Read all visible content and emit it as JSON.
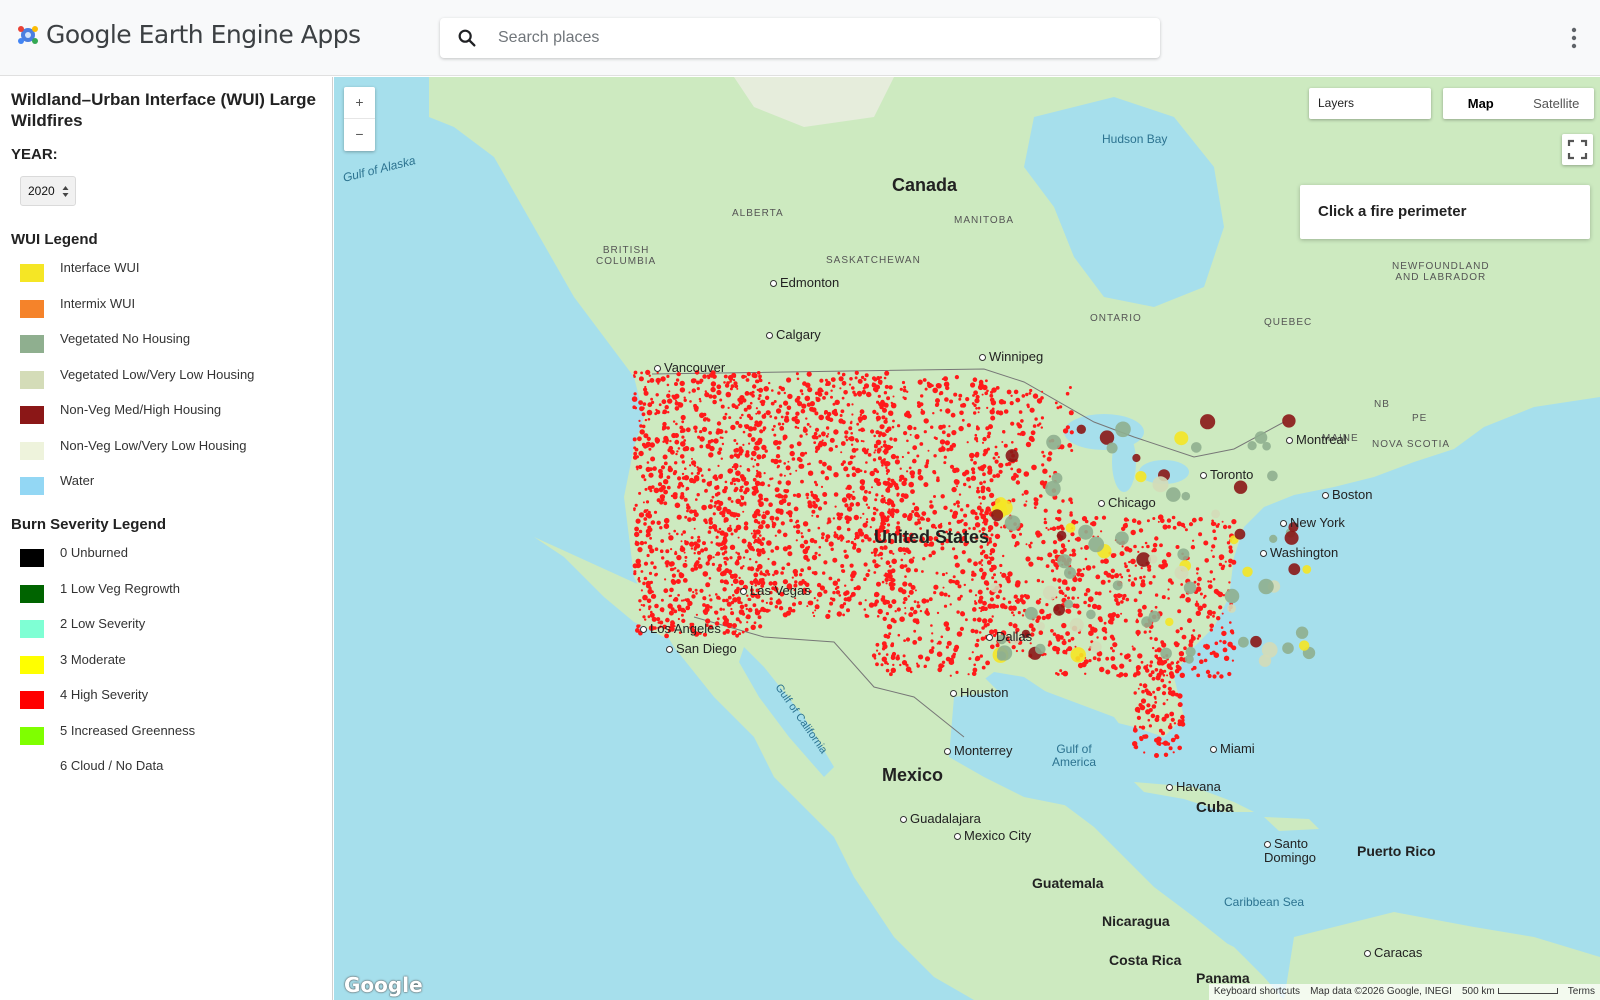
{
  "header": {
    "app_title": "Google Earth Engine Apps",
    "search_placeholder": "Search places"
  },
  "panel": {
    "title": "Wildland–Urban Interface (WUI) Large Wildfires",
    "year_label": "YEAR:",
    "year_value": "2020",
    "wui_legend": {
      "title": "WUI Legend",
      "items": [
        {
          "label": "Interface WUI",
          "color": "#f5e625"
        },
        {
          "label": "Intermix WUI",
          "color": "#f5832a"
        },
        {
          "label": "Vegetated No Housing",
          "color": "#8faf8f"
        },
        {
          "label": "Vegetated Low/Very Low Housing",
          "color": "#d4dcb8"
        },
        {
          "label": "Non-Veg Med/High Housing",
          "color": "#8b1717"
        },
        {
          "label": "Non-Veg Low/Very Low Housing",
          "color": "#eef3dc"
        },
        {
          "label": "Water",
          "color": "#93d7f4"
        }
      ]
    },
    "burn_legend": {
      "title": "Burn Severity Legend",
      "items": [
        {
          "label": "0 Unburned",
          "color": "#000000"
        },
        {
          "label": "1 Low Veg Regrowth",
          "color": "#006400"
        },
        {
          "label": "2 Low Severity",
          "color": "#7fffd4"
        },
        {
          "label": "3 Moderate",
          "color": "#ffff00"
        },
        {
          "label": "4 High Severity",
          "color": "#ff0000"
        },
        {
          "label": "5 Increased Greenness",
          "color": "#7fff00"
        },
        {
          "label": "6 Cloud / No Data",
          "color": "#ffffff"
        }
      ]
    }
  },
  "map": {
    "zoom_in": "+",
    "zoom_out": "−",
    "layers_label": "Layers",
    "map_type": {
      "map": "Map",
      "satellite": "Satellite"
    },
    "info_prompt": "Click a fire perimeter",
    "google_logo": "Google",
    "attribution": {
      "shortcuts": "Keyboard shortcuts",
      "data": "Map data ©2026 Google, INEGI",
      "scale": "500 km",
      "terms": "Terms"
    },
    "labels": {
      "countries": {
        "canada": "Canada",
        "us": "United States",
        "mexico": "Mexico",
        "cuba": "Cuba",
        "puerto_rico": "Puerto Rico",
        "guatemala": "Guatemala",
        "nicaragua": "Nicaragua",
        "costa_rica": "Costa Rica",
        "panama": "Panama"
      },
      "provinces": {
        "alberta": "ALBERTA",
        "bc": "BRITISH\nCOLUMBIA",
        "sask": "SASKATCHEWAN",
        "manitoba": "MANITOBA",
        "ontario": "ONTARIO",
        "quebec": "QUEBEC",
        "nl": "NEWFOUNDLAND\nAND LABRADOR",
        "nb": "NB",
        "pe": "PE",
        "ns": "NOVA SCOTIA",
        "maine": "MAINE"
      },
      "cities": {
        "edmonton": "Edmonton",
        "calgary": "Calgary",
        "vancouver": "Vancouver",
        "winnipeg": "Winnipeg",
        "montreal": "Montreal",
        "boston": "Boston",
        "new_york": "New York",
        "washington": "Washington",
        "chicago": "Chicago",
        "los_angeles": "Los Angeles",
        "san_diego": "San Diego",
        "houston": "Houston",
        "dallas": "Dallas",
        "miami": "Miami",
        "monterrey": "Monterrey",
        "guadalajara": "Guadalajara",
        "mexico_city": "Mexico City",
        "havana": "Havana",
        "santo_domingo": "Santo\nDomingo",
        "caracas": "Caracas",
        "toronto": "Toronto",
        "las_vegas": "Las Vegas"
      },
      "water": {
        "hudson_bay": "Hudson Bay",
        "gulf_alaska": "Gulf of Alaska",
        "gulf_mexico": "Gulf of\nAmerica",
        "gulf_california": "Gulf of California",
        "caribbean": "Caribbean Sea"
      }
    }
  },
  "colors": {
    "fire_red": "#ff1a1a",
    "land": "#cdeac0",
    "water": "#a6dfec"
  }
}
